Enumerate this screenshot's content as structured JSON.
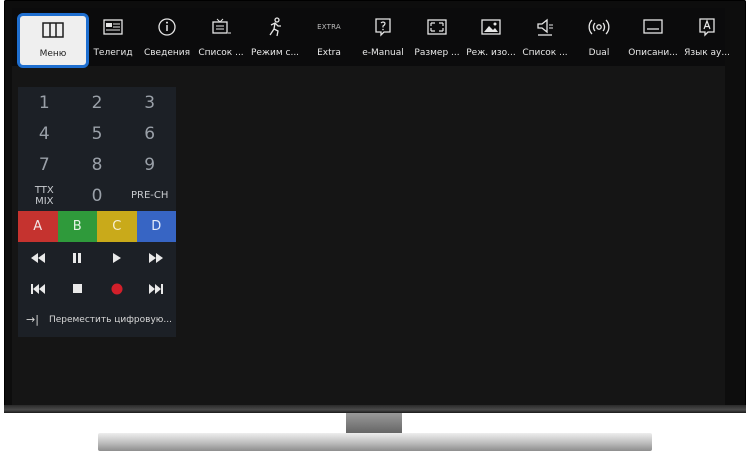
{
  "topbar": {
    "selected": {
      "label": "Меню",
      "icon": "menu-icon"
    },
    "items": [
      {
        "label": "Телегид",
        "icon": "guide-icon"
      },
      {
        "label": "Сведения",
        "icon": "info-icon"
      },
      {
        "label": "Список ...",
        "icon": "channel-list-icon"
      },
      {
        "label": "Режим с...",
        "icon": "sport-mode-icon"
      },
      {
        "label": "Extra",
        "icon_text": "EXTRA",
        "icon": "extra-icon"
      },
      {
        "label": "e-Manual",
        "icon": "help-icon"
      },
      {
        "label": "Размер ...",
        "icon": "picture-size-icon"
      },
      {
        "label": "Реж. изо...",
        "icon": "picture-mode-icon"
      },
      {
        "label": "Список ...",
        "icon": "sound-output-icon"
      },
      {
        "label": "Dual",
        "icon": "dual-icon"
      },
      {
        "label": "Описани...",
        "icon": "subtitle-icon"
      },
      {
        "label": "Язык ау...",
        "icon": "audio-language-icon"
      }
    ]
  },
  "keypad": {
    "digits": [
      [
        "1",
        "2",
        "3"
      ],
      [
        "4",
        "5",
        "6"
      ],
      [
        "7",
        "8",
        "9"
      ]
    ],
    "ttx": "TTX\nMIX",
    "zero": "0",
    "prech": "PRE-CH",
    "colors": [
      "A",
      "B",
      "C",
      "D"
    ],
    "footer": "Переместить цифровую..."
  },
  "colors": {
    "highlight_border": "#1f6fd0",
    "key_a": "#c5332f",
    "key_b": "#2f9a3b",
    "key_c": "#c9aa1a",
    "key_d": "#3765c4",
    "record": "#d21f2a"
  }
}
